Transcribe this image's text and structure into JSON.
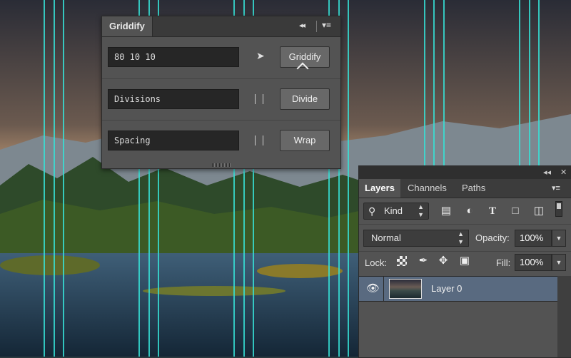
{
  "griddify": {
    "title": "Griddify",
    "collapse_glyph": "◂◂",
    "menu_glyph": "▾≡",
    "rows": [
      {
        "field": "80 10 10",
        "action": "Griddify",
        "mode": "arrow"
      },
      {
        "field": "Divisions",
        "action": "Divide",
        "mode": "checkbox"
      },
      {
        "field": "Spacing",
        "action": "Wrap",
        "mode": "checkbox"
      }
    ]
  },
  "layers_panel": {
    "collapse_glyph": "◂◂",
    "close_glyph": "✕",
    "menu_glyph": "▾≡",
    "tabs": [
      "Layers",
      "Channels",
      "Paths"
    ],
    "active_tab": "Layers",
    "filter": {
      "label": "Kind"
    },
    "blend_mode": "Normal",
    "opacity_label": "Opacity:",
    "opacity_value": "100%",
    "lock_label": "Lock:",
    "fill_label": "Fill:",
    "fill_value": "100%",
    "layers": [
      {
        "name": "Layer 0",
        "visible": true
      }
    ]
  },
  "colors": {
    "guide": "#36e0d6",
    "panel": "#535353",
    "selected_layer": "#596a80"
  }
}
